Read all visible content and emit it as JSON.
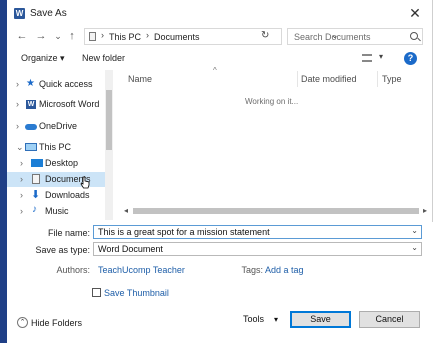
{
  "window": {
    "title": "Save As",
    "app_icon": "W"
  },
  "nav": {
    "back": "←",
    "forward": "→",
    "recent": "⌄",
    "up": "↑",
    "breadcrumb": [
      "This PC",
      "Documents"
    ],
    "separator": "›",
    "refresh": "↻",
    "search_placeholder": "Search Documents"
  },
  "toolbar": {
    "organize": "Organize ▾",
    "new_folder": "New folder",
    "help": "?"
  },
  "sidebar": {
    "items": [
      {
        "label": "Quick access",
        "chevron": "›"
      },
      {
        "label": "Microsoft Word",
        "chevron": "›"
      },
      {
        "label": "OneDrive",
        "chevron": "›"
      },
      {
        "label": "This PC",
        "chevron": "⌄"
      },
      {
        "label": "Desktop",
        "chevron": "›"
      },
      {
        "label": "Documents",
        "chevron": "›"
      },
      {
        "label": "Downloads",
        "chevron": "›"
      },
      {
        "label": "Music",
        "chevron": "›"
      }
    ]
  },
  "files": {
    "columns": [
      "Name",
      "Date modified",
      "Type"
    ],
    "status": "Working on it..."
  },
  "form": {
    "file_name_label": "File name:",
    "file_name_value": "This is a great spot for a mission statement",
    "save_as_type_label": "Save as type:",
    "save_as_type_value": "Word Document",
    "authors_label": "Authors:",
    "authors_value": "TeachUcomp Teacher",
    "tags_label": "Tags:",
    "tags_value": "Add a tag",
    "save_thumbnail": "Save Thumbnail"
  },
  "footer": {
    "hide_folders": "Hide Folders",
    "tools": "Tools",
    "save": "Save",
    "cancel": "Cancel"
  },
  "colors": {
    "accent": "#0078d7",
    "selection": "#cce4f7",
    "link": "#1e5ea8",
    "word_blue": "#2b579a"
  }
}
